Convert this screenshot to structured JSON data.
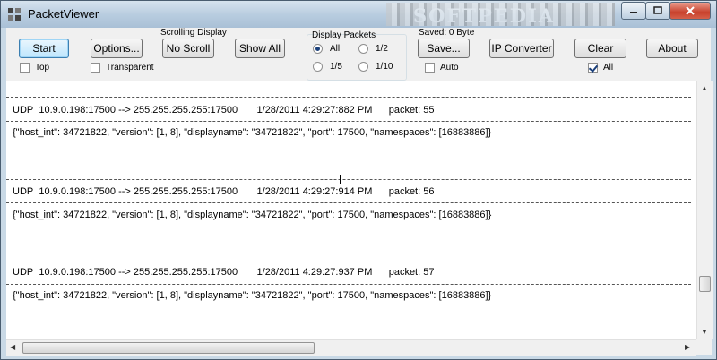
{
  "window": {
    "title": "PacketViewer",
    "watermark": "SOFTPEDIA"
  },
  "toolbar": {
    "start_label": "Start",
    "options_label": "Options...",
    "scrolling_caption": "Scrolling Display",
    "noscroll_label": "No Scroll",
    "showall_label": "Show All",
    "display_packets_caption": "Display Packets",
    "radio_all": "All",
    "radio_half": "1/2",
    "radio_fifth": "1/5",
    "radio_tenth": "1/10",
    "saved_caption": "Saved: 0 Byte",
    "save_label": "Save...",
    "ipconverter_label": "IP Converter",
    "clear_label": "Clear",
    "about_label": "About",
    "top_label": "Top",
    "transparent_label": "Transparent",
    "auto_label": "Auto",
    "all_label": "All",
    "top_checked": false,
    "transparent_checked": false,
    "auto_checked": false,
    "all_checked": true,
    "selected_radio": "All"
  },
  "packets": [
    {
      "protocol": "UDP",
      "source": "10.9.0.198:17500",
      "arrow": "-->",
      "dest": "255.255.255.255:17500",
      "timestamp": "1/28/2011 4:29:27:882 PM",
      "packet_label": "packet: 55",
      "payload": "{\"host_int\": 34721822, \"version\": [1, 8], \"displayname\": \"34721822\", \"port\": 17500, \"namespaces\": [16883886]}"
    },
    {
      "protocol": "UDP",
      "source": "10.9.0.198:17500",
      "arrow": "-->",
      "dest": "255.255.255.255:17500",
      "timestamp": "1/28/2011 4:29:27:914 PM",
      "packet_label": "packet: 56",
      "payload": "{\"host_int\": 34721822, \"version\": [1, 8], \"displayname\": \"34721822\", \"port\": 17500, \"namespaces\": [16883886]}"
    },
    {
      "protocol": "UDP",
      "source": "10.9.0.198:17500",
      "arrow": "-->",
      "dest": "255.255.255.255:17500",
      "timestamp": "1/28/2011 4:29:27:937 PM",
      "packet_label": "packet: 57",
      "payload": "{\"host_int\": 34721822, \"version\": [1, 8], \"displayname\": \"34721822\", \"port\": 17500, \"namespaces\": [16883886]}"
    }
  ],
  "icons": {
    "app": "app-icon",
    "minimize": "minimize-icon",
    "maximize": "maximize-icon",
    "close": "close-icon"
  }
}
